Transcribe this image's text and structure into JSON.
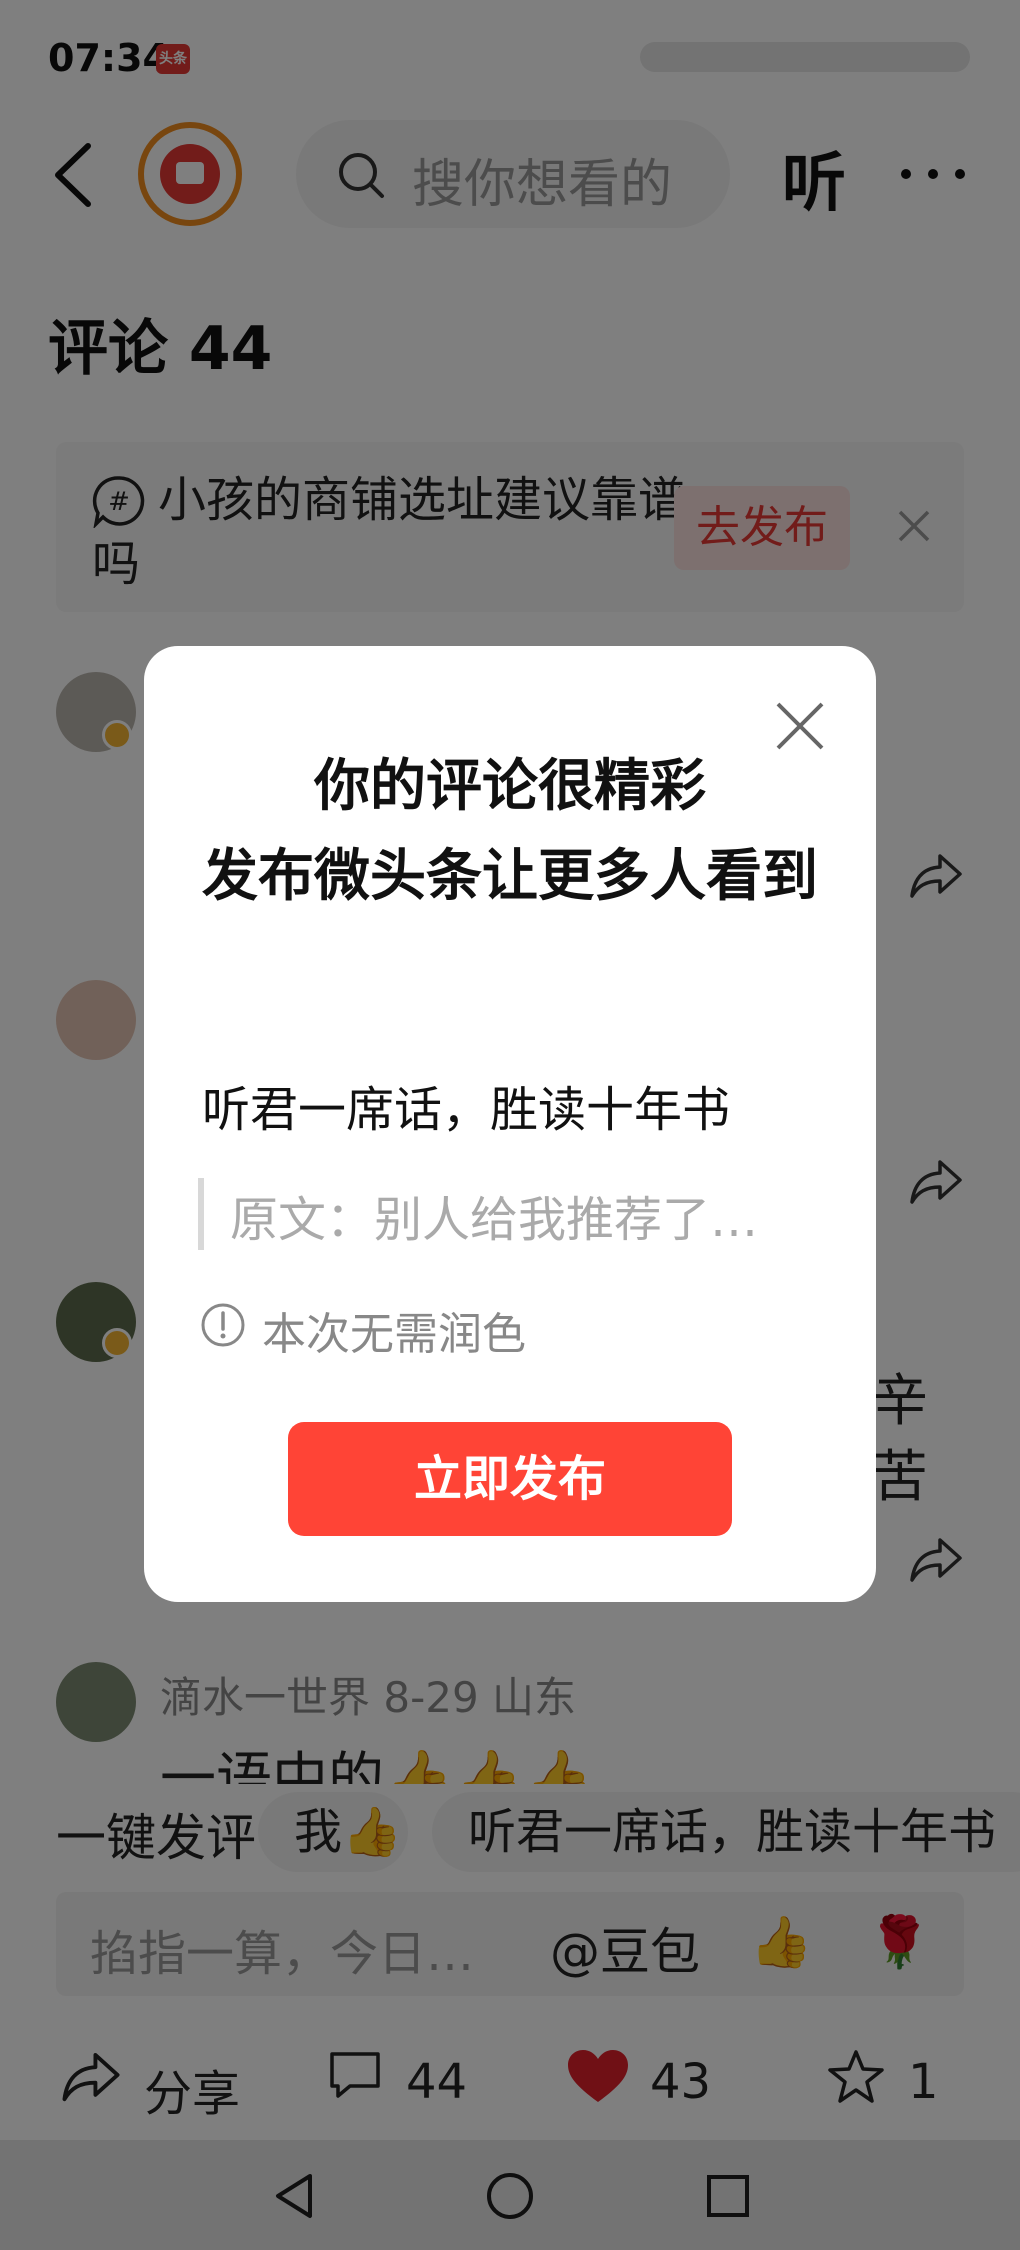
{
  "status_bar": {
    "time": "07:34",
    "app_badge": "头条"
  },
  "top_bar": {
    "search_placeholder": "搜你想看的",
    "listen_label": "听"
  },
  "comments": {
    "title": "评论 44",
    "topic_card": {
      "text": "小孩的商铺选址建议靠谱吗",
      "publish_label": "去发布"
    },
    "partial_texts": [
      "辛",
      "苦"
    ],
    "last_comment": {
      "meta": "滴水一世界  8-29  山东",
      "content": "一语中的👍👍👍"
    }
  },
  "quick_bar": {
    "label": "一键发评",
    "chips": [
      "我👍",
      "听君一席话，胜读十年书"
    ]
  },
  "input_bar": {
    "placeholder": "掐指一算，今日…",
    "mention_label": "@豆包",
    "emojis": [
      "👍",
      "🌹"
    ]
  },
  "bottom_actions": {
    "share_label": "分享",
    "comment_count": "44",
    "like_count": "43",
    "favorite_count": "1"
  },
  "modal": {
    "title_lines": [
      "你的评论很精彩",
      "发布微头条让更多人看到"
    ],
    "comment_text": "听君一席话，胜读十年书",
    "quote_text": "原文：别人给我推荐了…",
    "info_text": "本次无需润色",
    "publish_label": "立即发布"
  },
  "colors": {
    "accent": "#ff4436",
    "like": "#e0202b",
    "overlay": "rgba(0,0,0,0.5)"
  }
}
